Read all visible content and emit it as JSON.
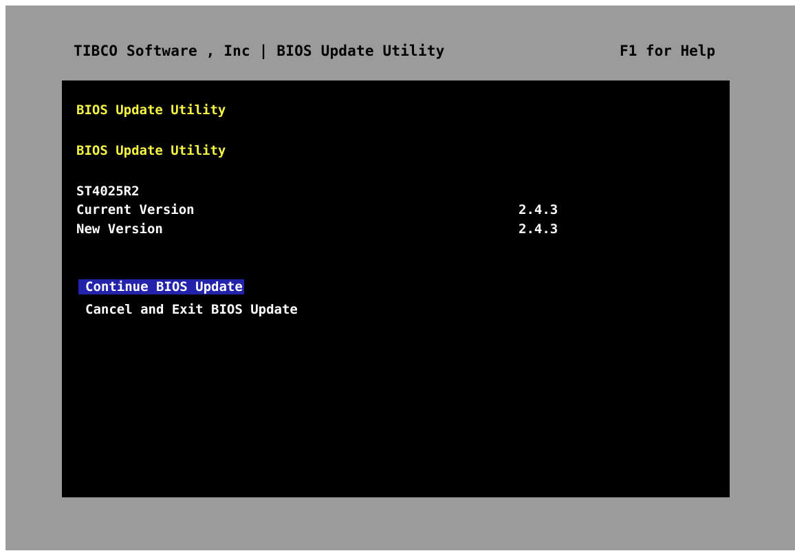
{
  "header": {
    "title": "TIBCO Software , Inc | BIOS Update Utility",
    "help_hint": "F1 for Help"
  },
  "panel": {
    "title_1": "BIOS Update Utility",
    "title_2": "BIOS Update Utility",
    "model": "ST4025R2",
    "current_version_label": "Current Version",
    "current_version_value": "2.4.3",
    "new_version_label": "New Version",
    "new_version_value": "2.4.3"
  },
  "menu": {
    "items": [
      {
        "label": "Continue BIOS Update",
        "selected": true
      },
      {
        "label": "Cancel and Exit BIOS Update",
        "selected": false
      }
    ]
  },
  "colors": {
    "screen_bg": "#9b9b9b",
    "panel_bg": "#000000",
    "heading": "#f5f542",
    "text": "#ffffff",
    "selection": "#2222aa"
  }
}
